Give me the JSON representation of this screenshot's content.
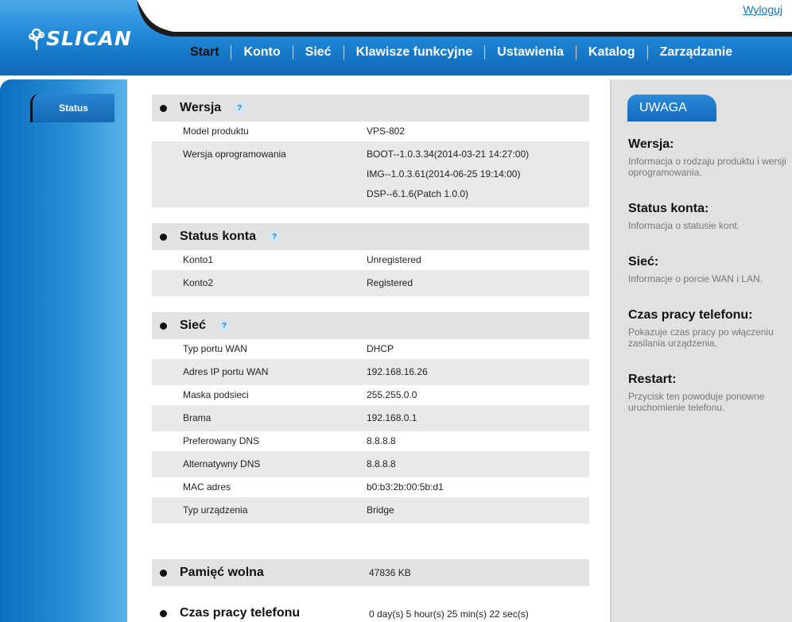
{
  "header": {
    "logout_label": "Wyloguj",
    "logo_text": "SLICAN",
    "nav": [
      "Start",
      "Konto",
      "Sieć",
      "Klawisze funkcyjne",
      "Ustawienia",
      "Katalog",
      "Zarządzanie"
    ],
    "active_nav": "Start"
  },
  "sidebar": {
    "status_label": "Status"
  },
  "sections": {
    "wersja": {
      "title": "Wersja",
      "help": "?",
      "model_label": "Model produktu",
      "model_value": "VPS-802",
      "software_label": "Wersja oprogramowania",
      "software_values": [
        "BOOT--1.0.3.34(2014-03-21 14:27:00)",
        "IMG--1.0.3.61(2014-06-25 19:14:00)",
        "DSP--6.1.6(Patch 1.0.0)"
      ]
    },
    "status_konta": {
      "title": "Status konta",
      "help": "?",
      "rows": [
        {
          "label": "Konto1",
          "value": "Unregistered"
        },
        {
          "label": "Konto2",
          "value": "Registered"
        }
      ]
    },
    "siec": {
      "title": "Sieć",
      "help": "?",
      "rows": [
        {
          "label": "Typ portu WAN",
          "value": "DHCP"
        },
        {
          "label": "Adres IP portu WAN",
          "value": "192.168.16.26"
        },
        {
          "label": "Maska podsieci",
          "value": "255.255.0.0"
        },
        {
          "label": "Brama",
          "value": "192.168.0.1"
        },
        {
          "label": "Preferowany DNS",
          "value": "8.8.8.8"
        },
        {
          "label": "Alternatywny DNS",
          "value": "8.8.8.8"
        },
        {
          "label": "MAC adres",
          "value": "b0:b3:2b:00:5b:d1"
        },
        {
          "label": "Typ urządzenia",
          "value": "Bridge"
        }
      ]
    },
    "pamiec": {
      "title": "Pamięć wolna",
      "value": "47836 KB"
    },
    "czas": {
      "title": "Czas pracy telefonu",
      "value": "0 day(s) 5 hour(s) 25 min(s) 22 sec(s)"
    }
  },
  "notes": {
    "heading": "UWAGA",
    "items": [
      {
        "title": "Wersja:",
        "text": "Informacja o rodzaju produktu i wersji oprogramowania."
      },
      {
        "title": "Status konta:",
        "text": "Informacja o statusie kont."
      },
      {
        "title": "Sieć:",
        "text": "Informacje o porcie WAN i LAN."
      },
      {
        "title": "Czas pracy telefonu:",
        "text": "Pokazuje czas pracy po włączeniu zasilania urządzenia."
      },
      {
        "title": "Restart:",
        "text": "Przycisk ten powoduje ponowne uruchomienie telefonu."
      }
    ]
  },
  "colors": {
    "brand_blue": "#1a78c8",
    "panel_gray": "#e1e1e1",
    "bar_gray": "#e2e2e2"
  }
}
